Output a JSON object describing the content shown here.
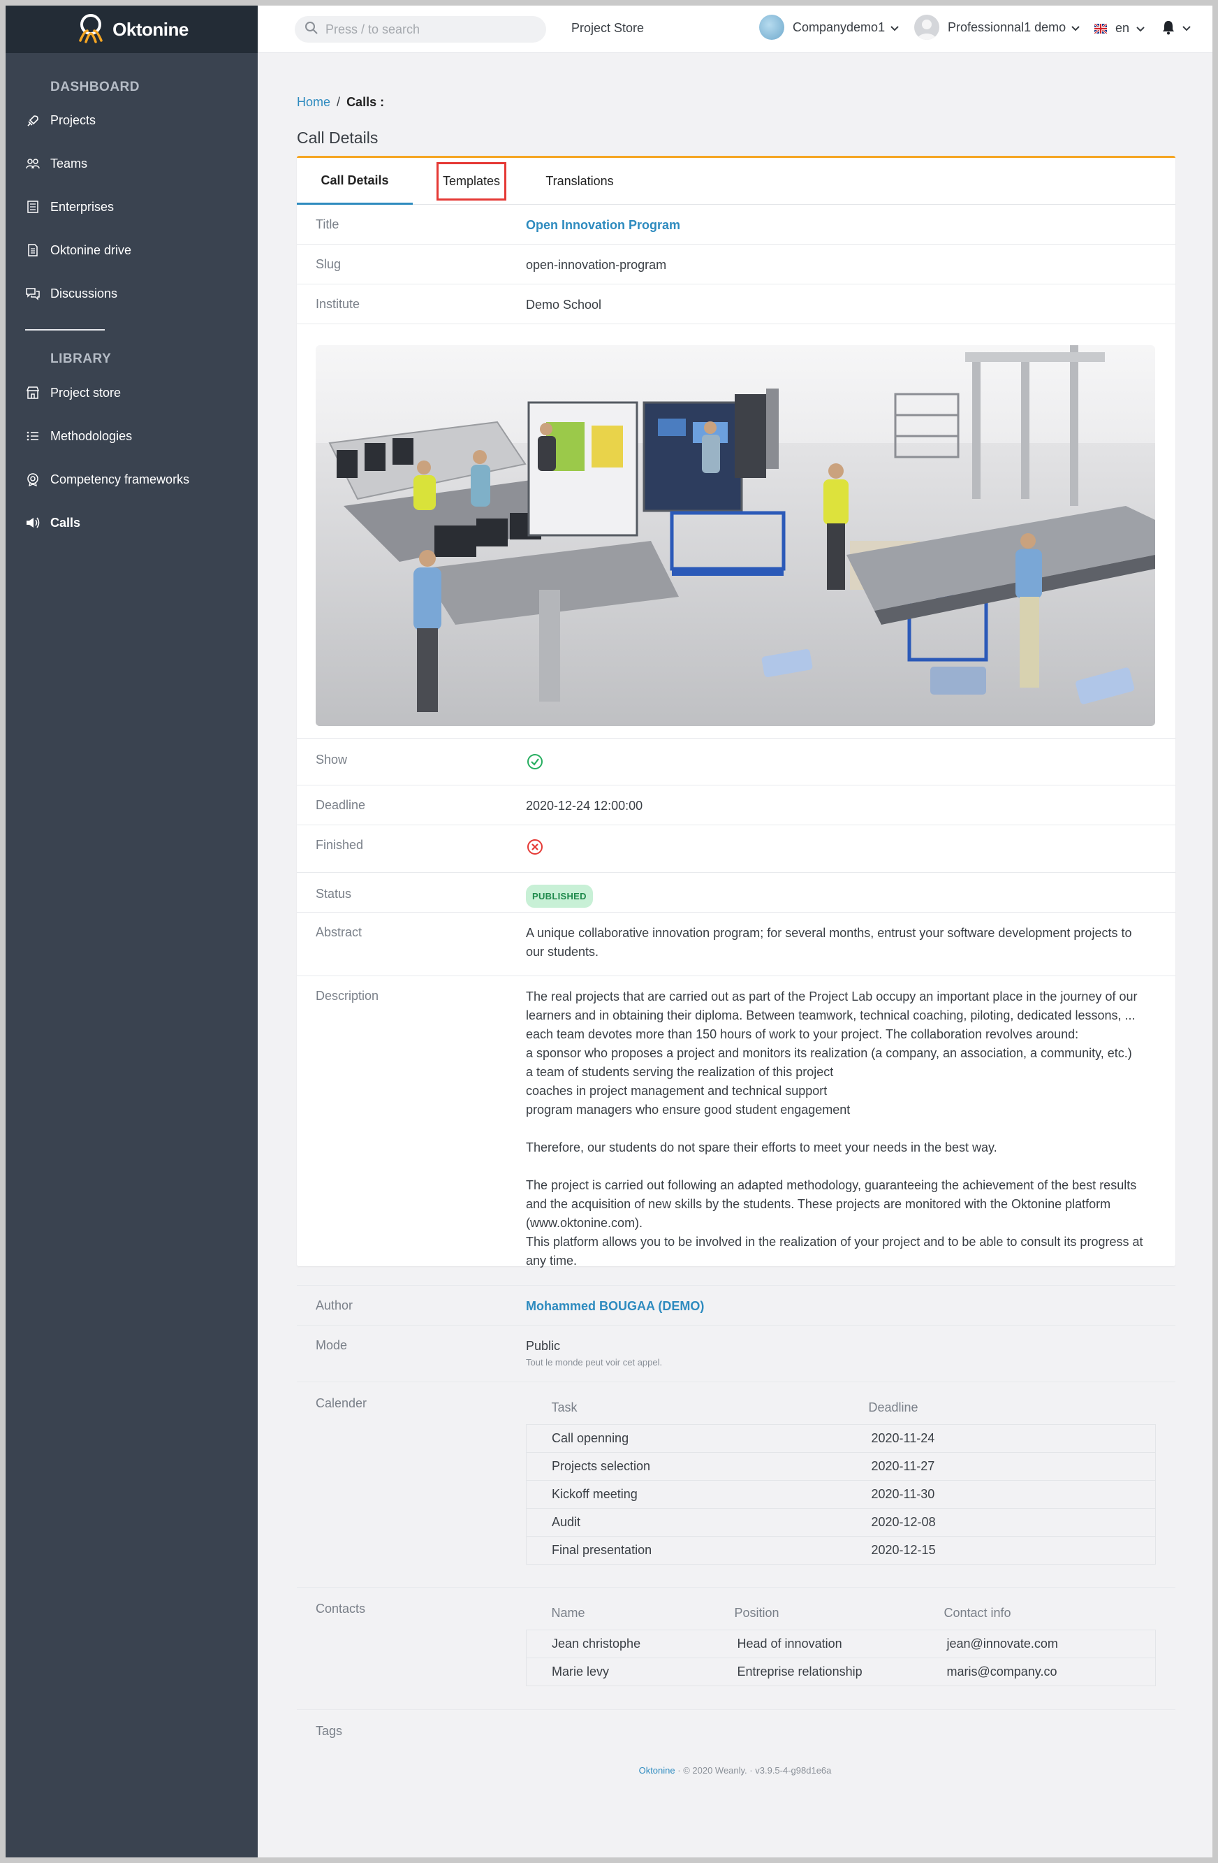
{
  "app": {
    "name": "Oktonine"
  },
  "topbar": {
    "search_placeholder": "Press / to search",
    "project_store": "Project Store",
    "company": "Companydemo1",
    "user": "Professionnal1 demo",
    "language": "en"
  },
  "sidebar": {
    "dashboard_section": "DASHBOARD",
    "dashboard_items": [
      {
        "label": "Projects",
        "icon": "rocket-icon"
      },
      {
        "label": "Teams",
        "icon": "people-icon"
      },
      {
        "label": "Enterprises",
        "icon": "building-icon"
      },
      {
        "label": "Oktonine drive",
        "icon": "drive-icon"
      },
      {
        "label": "Discussions",
        "icon": "chat-icon"
      }
    ],
    "library_section": "LIBRARY",
    "library_items": [
      {
        "label": "Project store",
        "icon": "store-icon"
      },
      {
        "label": "Methodologies",
        "icon": "list-icon"
      },
      {
        "label": "Competency frameworks",
        "icon": "badge-icon"
      },
      {
        "label": "Calls",
        "icon": "megaphone-icon",
        "active": true
      }
    ]
  },
  "breadcrumb": {
    "home": "Home",
    "separator": "/",
    "current": "Calls :"
  },
  "page_title": "Call Details",
  "tabs": [
    {
      "label": "Call Details",
      "active": true
    },
    {
      "label": "Templates",
      "highlighted": true
    },
    {
      "label": "Translations"
    }
  ],
  "details": {
    "title_label": "Title",
    "title_value": "Open Innovation Program",
    "slug_label": "Slug",
    "slug_value": "open-innovation-program",
    "institute_label": "Institute",
    "institute_value": "Demo School",
    "show_label": "Show",
    "show_value": true,
    "deadline_label": "Deadline",
    "deadline_value": "2020-12-24 12:00:00",
    "finished_label": "Finished",
    "finished_value": false,
    "status_label": "Status",
    "status_value": "PUBLISHED",
    "abstract_label": "Abstract",
    "abstract_lines": [
      "A unique collaborative innovation program; for several months, entrust your software development projects to",
      "our students."
    ],
    "description_label": "Description",
    "description_lines": [
      "The real projects that are carried out as part of the Project Lab occupy an important place in the journey of our",
      "learners and in obtaining their diploma. Between teamwork, technical coaching, piloting, dedicated lessons, ...",
      "each team devotes more than 150 hours of work to your project. The collaboration revolves around:",
      "a sponsor who proposes a project and monitors its realization (a company, an association, a community, etc.)",
      "a team of students serving the realization of this project",
      "coaches in project management and technical support",
      "program managers who ensure good student engagement",
      "",
      "Therefore, our students do not spare their efforts to meet your needs in the best way.",
      "",
      "The project is carried out following an adapted methodology, guaranteeing the achievement of the best results",
      "and the acquisition of new skills by the students. These projects are monitored with the Oktonine platform",
      "(www.oktonine.com).",
      "This platform allows you to be involved in the realization of your project and to be able to consult its progress at",
      "any time."
    ],
    "author_label": "Author",
    "author_value": "Mohammed BOUGAA (DEMO)",
    "mode_label": "Mode",
    "mode_value": "Public",
    "mode_sub": "Tout le monde peut voir cet appel.",
    "calendar_label": "Calender",
    "calendar_headers": [
      "Task",
      "Deadline"
    ],
    "calendar_rows": [
      [
        "Call openning",
        "2020-11-24"
      ],
      [
        "Projects selection",
        "2020-11-27"
      ],
      [
        "Kickoff meeting",
        "2020-11-30"
      ],
      [
        "Audit",
        "2020-12-08"
      ],
      [
        "Final presentation",
        "2020-12-15"
      ]
    ],
    "contacts_label": "Contacts",
    "contacts_headers": [
      "Name",
      "Position",
      "Contact info"
    ],
    "contacts_rows": [
      [
        "Jean christophe",
        "Head of innovation",
        "jean@innovate.com"
      ],
      [
        "Marie levy",
        "Entreprise relationship",
        "maris@company.co"
      ]
    ],
    "tags_label": "Tags"
  },
  "footer": {
    "brand": "Oktonine",
    "copyright": "· © 2020 Weanly. ·",
    "version": "v3.9.5-4-g98d1e6a"
  },
  "colors": {
    "accent": "#2e8bbf",
    "sidebar": "#3a4350",
    "brand_orange": "#f5a623",
    "success": "#27ae60",
    "danger": "#e53935"
  }
}
